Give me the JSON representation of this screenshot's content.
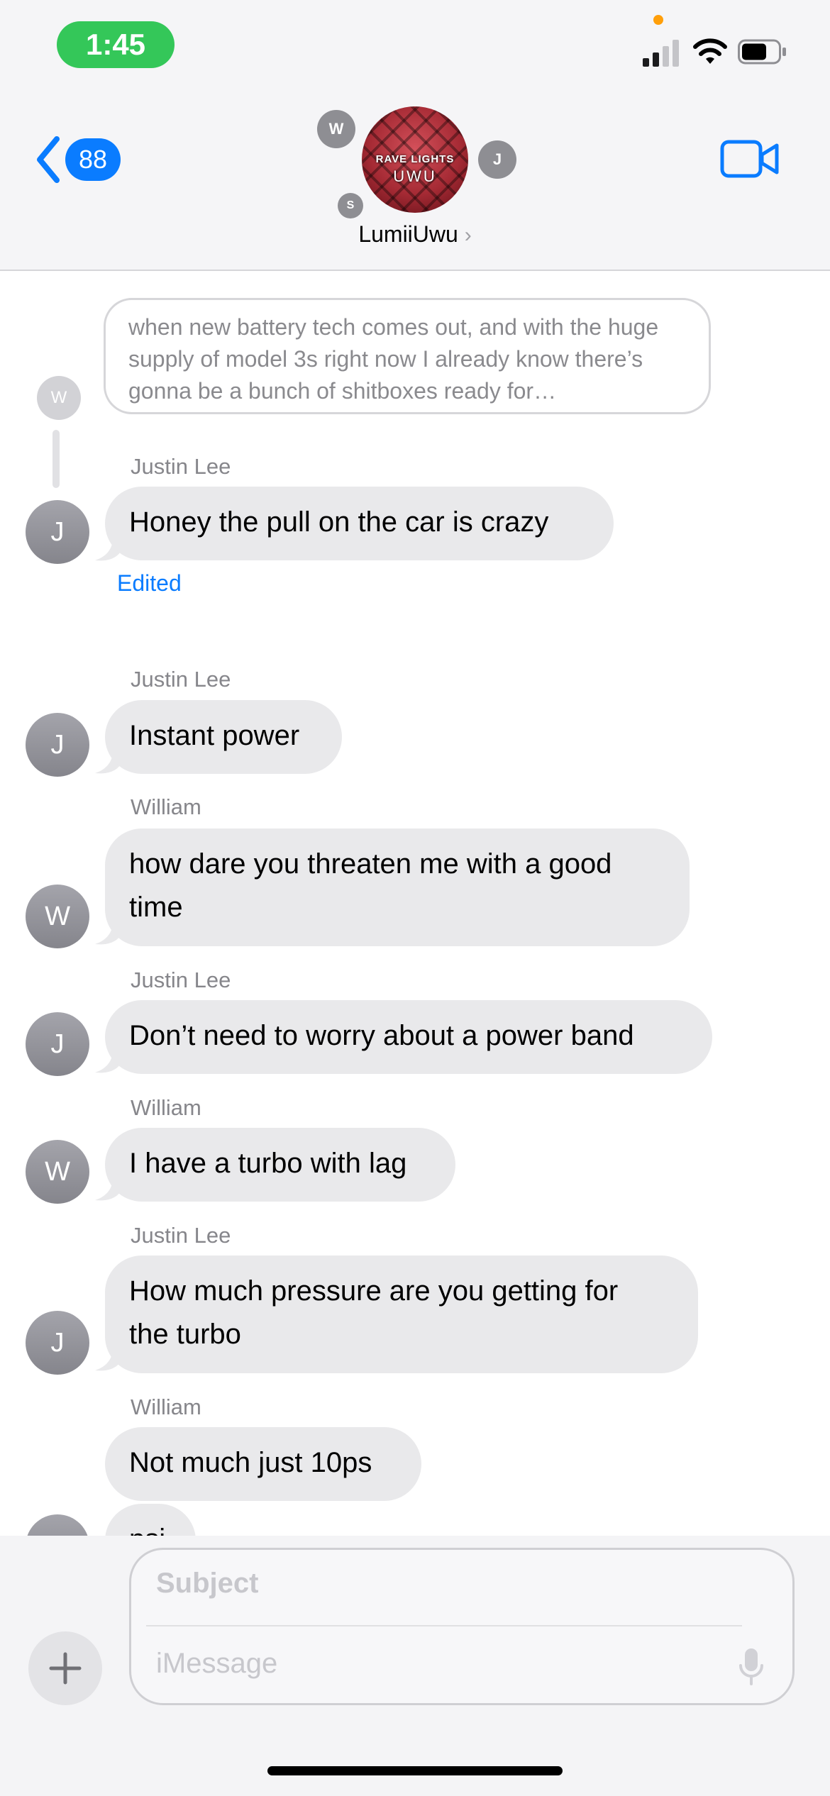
{
  "status_bar": {
    "time": "1:45"
  },
  "header": {
    "back_count": "88",
    "group_name": "LumiiUwu",
    "photo_line1": "RAVE LIGHTS",
    "photo_line2": "UWU",
    "member_initials": [
      "W",
      "J",
      "S"
    ]
  },
  "quoted_reply": {
    "author_initial": "W",
    "text": "when new battery tech comes out, and with the huge supply of model 3s right now I already know there’s gonna be a bunch of shitboxes ready for…"
  },
  "messages": [
    {
      "sender": "Justin Lee",
      "initial": "J",
      "lines": [
        "Honey the pull on the car is crazy"
      ],
      "status": "Edited"
    },
    {
      "sender": "Justin Lee",
      "initial": "J",
      "lines": [
        "Instant power"
      ]
    },
    {
      "sender": "William",
      "initial": "W",
      "lines": [
        "how dare you threaten me with a good",
        "time"
      ]
    },
    {
      "sender": "Justin Lee",
      "initial": "J",
      "lines": [
        "Don’t need to worry about a power band"
      ]
    },
    {
      "sender": "William",
      "initial": "W",
      "lines": [
        "I have a turbo with lag"
      ]
    },
    {
      "sender": "Justin Lee",
      "initial": "J",
      "lines": [
        "How much pressure are you getting for",
        "the turbo"
      ]
    },
    {
      "sender": "William",
      "initial": "",
      "lines": [
        "Not much just 10ps"
      ]
    },
    {
      "sender": "",
      "initial": "",
      "lines": [
        "psi"
      ]
    }
  ],
  "compose": {
    "subject_placeholder": "Subject",
    "message_placeholder": "iMessage"
  },
  "icons": [
    "back-chevron-icon",
    "video-camera-icon",
    "plus-icon",
    "microphone-icon",
    "signal-icon",
    "wifi-icon",
    "battery-icon"
  ],
  "colors": {
    "accent": "#0a7cff",
    "bubble": "#e9e9eb",
    "status_green": "#34c759",
    "avatar_gray": "#8e8e93"
  }
}
